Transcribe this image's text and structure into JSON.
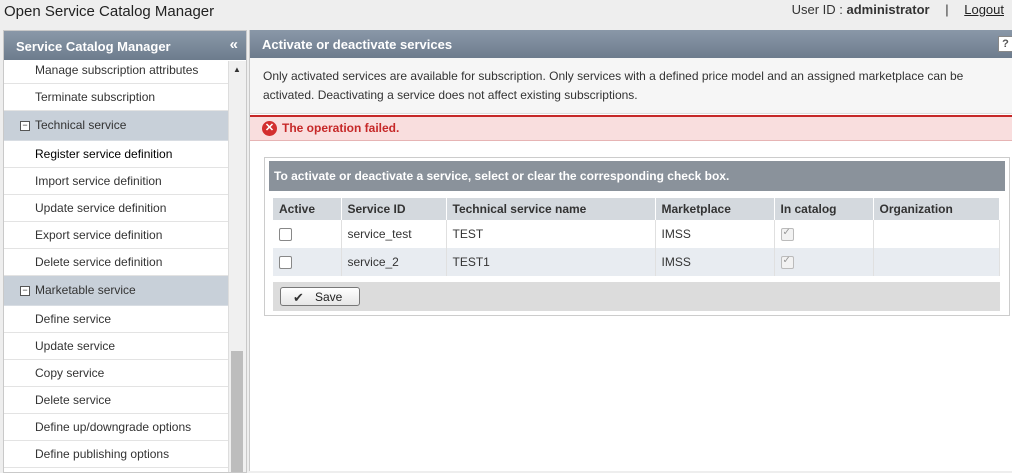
{
  "app": {
    "title": "Open Service Catalog Manager"
  },
  "user": {
    "label": "User ID :",
    "id": "administrator",
    "separator": "|",
    "logout": "Logout"
  },
  "sidebar": {
    "title": "Service Catalog Manager",
    "collapse_glyph": "«",
    "items": [
      {
        "type": "item",
        "label": "Manage subscription attributes"
      },
      {
        "type": "item",
        "label": "Terminate subscription"
      },
      {
        "type": "group",
        "label": "Technical service",
        "toggle": "−"
      },
      {
        "type": "item",
        "label": "Register service definition",
        "active": true
      },
      {
        "type": "item",
        "label": "Import service definition"
      },
      {
        "type": "item",
        "label": "Update service definition"
      },
      {
        "type": "item",
        "label": "Export service definition"
      },
      {
        "type": "item",
        "label": "Delete service definition"
      },
      {
        "type": "group",
        "label": "Marketable service",
        "toggle": "−"
      },
      {
        "type": "item",
        "label": "Define service"
      },
      {
        "type": "item",
        "label": "Update service"
      },
      {
        "type": "item",
        "label": "Copy service"
      },
      {
        "type": "item",
        "label": "Delete service"
      },
      {
        "type": "item",
        "label": "Define up/downgrade options"
      },
      {
        "type": "item",
        "label": "Define publishing options"
      }
    ]
  },
  "main": {
    "title": "Activate or deactivate services",
    "help_glyph": "?",
    "intro": "Only activated services are available for subscription. Only services with a defined price model and an assigned marketplace can be activated. Deactivating a service does not affect existing subscriptions.",
    "error": "The operation failed.",
    "panel_header": "To activate or deactivate a service, select or clear the corresponding check box.",
    "columns": [
      "Active",
      "Service ID",
      "Technical service name",
      "Marketplace",
      "In catalog",
      "Organization"
    ],
    "rows": [
      {
        "active": false,
        "service_id": "service_test",
        "technical_service": "TEST",
        "marketplace": "IMSS",
        "in_catalog": true,
        "organization": ""
      },
      {
        "active": false,
        "service_id": "service_2",
        "technical_service": "TEST1",
        "marketplace": "IMSS",
        "in_catalog": true,
        "organization": ""
      }
    ],
    "save_label": "Save"
  },
  "colors": {
    "header_bg": "#7b8a9b",
    "error_red": "#c62828",
    "group_bg": "#c8d0d9",
    "row_alt": "#e8ecf1"
  }
}
